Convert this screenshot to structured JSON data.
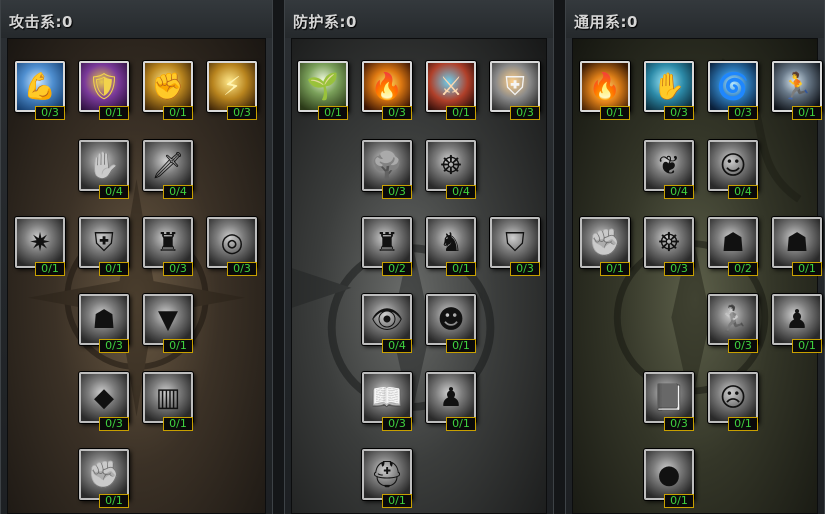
{
  "trees": [
    {
      "title": "攻击系:0",
      "skills": [
        {
          "name": "strength-icon",
          "glyph": "💪",
          "tone": "c-blue",
          "rank": "0/3"
        },
        {
          "name": "golden-warrior-icon",
          "glyph": "🛡",
          "tone": "c-purple",
          "rank": "0/1"
        },
        {
          "name": "golden-fist-icon",
          "glyph": "✊",
          "tone": "c-gold",
          "rank": "0/1"
        },
        {
          "name": "lightning-strike-icon",
          "glyph": "⚡",
          "tone": "c-gold",
          "rank": "0/3"
        },
        {
          "name": "claw-hand-icon",
          "glyph": "✋",
          "tone": "gray",
          "rank": "0/4"
        },
        {
          "name": "blade-icon",
          "glyph": "🗡",
          "tone": "gray",
          "rank": "0/4"
        },
        {
          "name": "power-aura-icon",
          "glyph": "✷",
          "tone": "gray",
          "rank": "0/1"
        },
        {
          "name": "shield-bash-icon",
          "glyph": "⛨",
          "tone": "gray",
          "rank": "0/1"
        },
        {
          "name": "armored-torso-icon",
          "glyph": "♜",
          "tone": "gray",
          "rank": "0/3"
        },
        {
          "name": "spiral-icon",
          "glyph": "◎",
          "tone": "gray",
          "rank": "0/3"
        },
        {
          "name": "flexing-warrior-icon",
          "glyph": "☗",
          "tone": "gray",
          "rank": "0/3"
        },
        {
          "name": "jaws-icon",
          "glyph": "▼",
          "tone": "gray",
          "rank": "0/1"
        },
        {
          "name": "crystal-shard-icon",
          "glyph": "◆",
          "tone": "gray",
          "rank": "0/3"
        },
        {
          "name": "cage-icon",
          "glyph": "▥",
          "tone": "gray",
          "rank": "0/1"
        },
        {
          "name": "iron-fist-icon",
          "glyph": "✊",
          "tone": "gray",
          "rank": "0/1"
        }
      ]
    },
    {
      "title": "防护系:0",
      "skills": [
        {
          "name": "sprout-icon",
          "glyph": "🌱",
          "tone": "c-green",
          "rank": "0/1"
        },
        {
          "name": "flaming-figure-icon",
          "glyph": "🔥",
          "tone": "c-fire",
          "rank": "0/3"
        },
        {
          "name": "caped-knight-icon",
          "glyph": "⚔",
          "tone": "c-red",
          "rank": "0/1"
        },
        {
          "name": "armor-chest-icon",
          "glyph": "⛨",
          "tone": "c-steel",
          "rank": "0/3"
        },
        {
          "name": "tree-icon",
          "glyph": "🌳",
          "tone": "gray",
          "rank": "0/3"
        },
        {
          "name": "meditation-icon",
          "glyph": "☸",
          "tone": "gray",
          "rank": "0/4"
        },
        {
          "name": "stone-golem-icon",
          "glyph": "♜",
          "tone": "gray",
          "rank": "0/2"
        },
        {
          "name": "armored-knight-icon",
          "glyph": "♞",
          "tone": "gray",
          "rank": "0/1"
        },
        {
          "name": "pauldron-icon",
          "glyph": "⛉",
          "tone": "gray",
          "rank": "0/3"
        },
        {
          "name": "watchful-eye-icon",
          "glyph": "👁",
          "tone": "gray",
          "rank": "0/4"
        },
        {
          "name": "helmet-head-icon",
          "glyph": "☻",
          "tone": "gray",
          "rank": "0/1"
        },
        {
          "name": "spellbook-blade-icon",
          "glyph": "📖",
          "tone": "gray",
          "rank": "0/3"
        },
        {
          "name": "chess-pawn-icon",
          "glyph": "♟",
          "tone": "gray",
          "rank": "0/1"
        },
        {
          "name": "knight-helm-icon",
          "glyph": "⛑",
          "tone": "gray",
          "rank": "0/1"
        }
      ]
    },
    {
      "title": "通用系:0",
      "skills": [
        {
          "name": "fire-aura-figure-icon",
          "glyph": "🔥",
          "tone": "c-orange",
          "rank": "0/1"
        },
        {
          "name": "healing-hands-icon",
          "glyph": "✋",
          "tone": "c-teal",
          "rank": "0/3"
        },
        {
          "name": "vortex-figure-icon",
          "glyph": "🌀",
          "tone": "c-sky",
          "rank": "0/3"
        },
        {
          "name": "swift-runner-icon",
          "glyph": "🏃",
          "tone": "c-dark",
          "rank": "0/1"
        },
        {
          "name": "wings-icon",
          "glyph": "❦",
          "tone": "gray",
          "rank": "0/4"
        },
        {
          "name": "mind-head-icon",
          "glyph": "☺",
          "tone": "gray",
          "rank": "0/4"
        },
        {
          "name": "gauntlet-icon",
          "glyph": "✊",
          "tone": "gray",
          "rank": "0/1"
        },
        {
          "name": "seated-monk-icon",
          "glyph": "☸",
          "tone": "gray",
          "rank": "0/3"
        },
        {
          "name": "muscular-figure-icon",
          "glyph": "☗",
          "tone": "gray",
          "rank": "0/2"
        },
        {
          "name": "shadow-figure-icon",
          "glyph": "☗",
          "tone": "gray",
          "rank": "0/1"
        },
        {
          "name": "dashing-figure-icon",
          "glyph": "🏃",
          "tone": "gray",
          "rank": "0/3"
        },
        {
          "name": "hunched-figure-icon",
          "glyph": "♟",
          "tone": "gray",
          "rank": "0/1"
        },
        {
          "name": "tome-icon",
          "glyph": "📕",
          "tone": "gray",
          "rank": "0/3"
        },
        {
          "name": "stone-face-icon",
          "glyph": "☹",
          "tone": "gray",
          "rank": "0/1"
        },
        {
          "name": "orb-icon",
          "glyph": "●",
          "tone": "gray",
          "rank": "0/1"
        }
      ]
    }
  ]
}
